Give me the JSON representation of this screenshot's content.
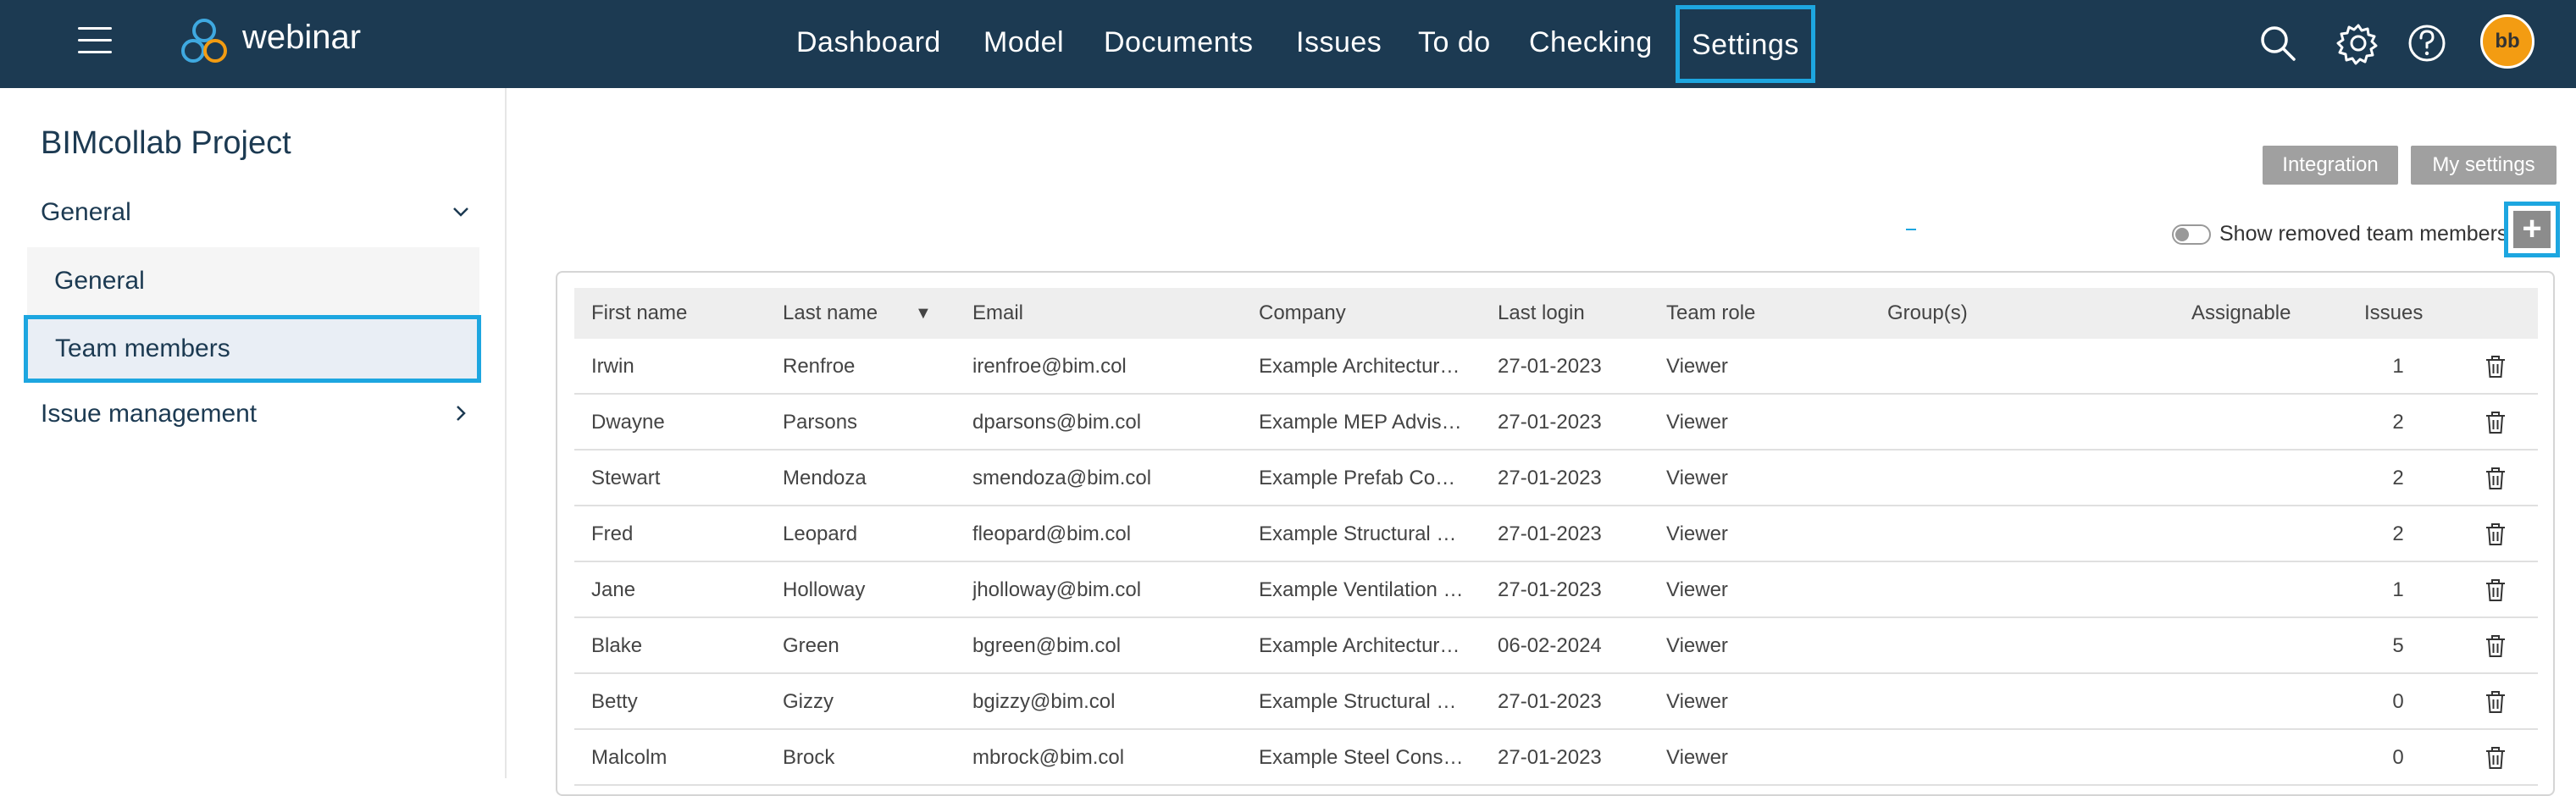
{
  "header": {
    "brand": "webinar",
    "nav": [
      "Dashboard",
      "Model",
      "Documents",
      "Issues",
      "To do",
      "Checking",
      "Settings"
    ],
    "active_nav": "Settings",
    "avatar_initials": "bb",
    "icons": [
      "menu-icon",
      "search-icon",
      "gear-icon",
      "help-icon"
    ]
  },
  "sidebar": {
    "project_title": "BIMcollab Project",
    "section_general": "General",
    "items": [
      "General",
      "Team members"
    ],
    "section_issue": "Issue management"
  },
  "toolbar": {
    "integration_label": "Integration",
    "my_settings_label": "My settings",
    "show_removed_label": "Show removed team members",
    "add_label": "+"
  },
  "table": {
    "headers": [
      "First name",
      "Last name",
      "Email",
      "Company",
      "Last login",
      "Team role",
      "Group(s)",
      "Assignable",
      "Issues"
    ],
    "sort_indicator": "▼",
    "rows": [
      [
        "Irwin",
        "Renfroe",
        "irenfroe@bim.col",
        "Example Architectur…",
        "27-01-2023",
        "Viewer",
        "",
        "",
        "1"
      ],
      [
        "Dwayne",
        "Parsons",
        "dparsons@bim.col",
        "Example MEP Advis…",
        "27-01-2023",
        "Viewer",
        "",
        "",
        "2"
      ],
      [
        "Stewart",
        "Mendoza",
        "smendoza@bim.col",
        "Example Prefab Co…",
        "27-01-2023",
        "Viewer",
        "",
        "",
        "2"
      ],
      [
        "Fred",
        "Leopard",
        "fleopard@bim.col",
        "Example Structural …",
        "27-01-2023",
        "Viewer",
        "",
        "",
        "2"
      ],
      [
        "Jane",
        "Holloway",
        "jholloway@bim.col",
        "Example Ventilation …",
        "27-01-2023",
        "Viewer",
        "",
        "",
        "1"
      ],
      [
        "Blake",
        "Green",
        "bgreen@bim.col",
        "Example Architectur…",
        "06-02-2024",
        "Viewer",
        "",
        "",
        "5"
      ],
      [
        "Betty",
        "Gizzy",
        "bgizzy@bim.col",
        "Example Structural …",
        "27-01-2023",
        "Viewer",
        "",
        "",
        "0"
      ],
      [
        "Malcolm",
        "Brock",
        "mbrock@bim.col",
        "Example Steel Cons…",
        "27-01-2023",
        "Viewer",
        "",
        "",
        "0"
      ]
    ]
  },
  "colors": {
    "header_bg": "#1c3a52",
    "highlight": "#1da6e0",
    "avatar": "#f39c12"
  }
}
